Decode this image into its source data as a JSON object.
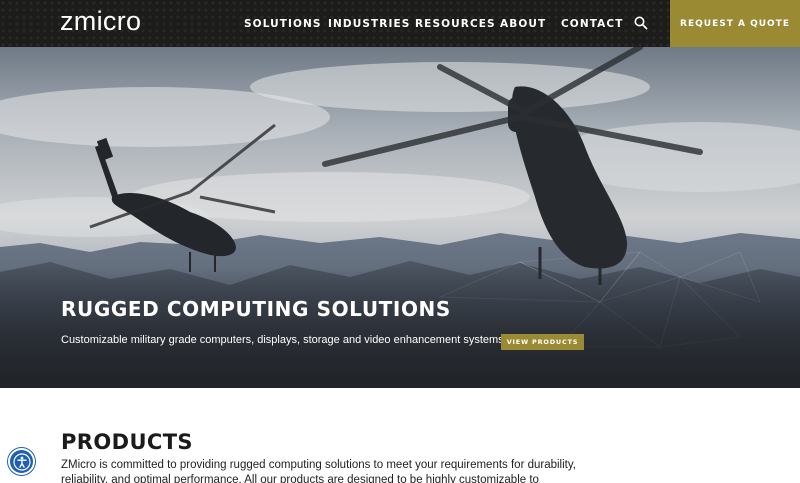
{
  "header": {
    "logo": "zmicro",
    "nav": [
      "SOLUTIONS",
      "INDUSTRIES",
      "RESOURCES",
      "ABOUT",
      "CONTACT"
    ],
    "search_icon": "search-icon",
    "quote_label": "REQUEST A QUOTE"
  },
  "hero": {
    "title": "RUGGED COMPUTING SOLUTIONS",
    "subtitle": "Customizable military grade computers, displays, storage and video enhancement systems.",
    "button_label": "VIEW PRODUCTS"
  },
  "products": {
    "title": "PRODUCTS",
    "text": "ZMicro is committed to providing rugged computing solutions to meet your requirements for durability, reliability, and optimal performance. All our products are designed to be highly customizable to"
  },
  "accessibility": {
    "icon": "accessibility-icon"
  },
  "colors": {
    "accent": "#9a8a33",
    "header_bg": "#1c1c1b",
    "a11y": "#1e5fb4"
  }
}
